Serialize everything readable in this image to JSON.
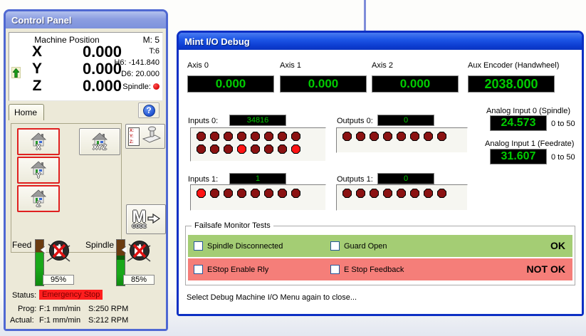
{
  "control_panel": {
    "title": "Control Panel",
    "machine_position": {
      "header": "Machine Position",
      "m": "M: 5",
      "t": "T:6",
      "h": "H6: -141.840",
      "d": "D6: 20.000",
      "spindle_label": "Spindle:",
      "axes": [
        {
          "letter": "X",
          "value": "0.000"
        },
        {
          "letter": "Y",
          "value": "0.000"
        },
        {
          "letter": "Z",
          "value": "0.000"
        }
      ]
    },
    "tab": "Home",
    "help_glyph": "?",
    "buttons": {
      "home_x": "X",
      "home_xyz": "XYZ",
      "home_y": "Y",
      "home_z": "Z"
    },
    "probe": {
      "x": "X:",
      "y": "Y:",
      "z": "Z:"
    },
    "mcode": {
      "m": "M",
      "code": "CODE"
    },
    "feed": {
      "label": "Feed",
      "percent": "95%"
    },
    "spindle_override": {
      "label": "Spindle",
      "percent": "85%"
    },
    "status": {
      "label": "Status:",
      "value": "Emergency Stop"
    },
    "prog": {
      "label": "Prog:",
      "feed": "F:1 mm/min",
      "speed": "S:250 RPM"
    },
    "actual": {
      "label": "Actual:",
      "feed": "F:1 mm/min",
      "speed": "S:212 RPM"
    }
  },
  "io_debug": {
    "title": "Mint I/O Debug",
    "axes": [
      {
        "label": "Axis 0",
        "value": "0.000"
      },
      {
        "label": "Axis 1",
        "value": "0.000"
      },
      {
        "label": "Axis 2",
        "value": "0.000"
      }
    ],
    "aux": {
      "label": "Aux Encoder (Handwheel)",
      "value": "2038.000"
    },
    "inputs0": {
      "label": "Inputs 0:",
      "value": "34816",
      "leds": [
        [
          0,
          0,
          0,
          0,
          0,
          0,
          0,
          0
        ],
        [
          0,
          0,
          0,
          1,
          0,
          0,
          0,
          1
        ]
      ]
    },
    "outputs0": {
      "label": "Outputs 0:",
      "value": "0",
      "leds": [
        [
          0,
          0,
          0,
          0,
          0,
          0,
          0,
          0
        ]
      ]
    },
    "inputs1": {
      "label": "Inputs 1:",
      "value": "1",
      "leds": [
        [
          1,
          0,
          0,
          0,
          0,
          0,
          0,
          0
        ]
      ]
    },
    "outputs1": {
      "label": "Outputs 1:",
      "value": "0",
      "leds": [
        [
          0,
          0,
          0,
          0,
          0,
          0,
          0,
          0
        ]
      ]
    },
    "analog0": {
      "label": "Analog Input 0 (Spindle)",
      "value": "24.573",
      "range": "0 to 50"
    },
    "analog1": {
      "label": "Analog Input 1 (Feedrate)",
      "value": "31.607",
      "range": "0 to 50"
    },
    "failsafe": {
      "title": "Failsafe Monitor Tests",
      "rows": [
        {
          "check1": "Spindle Disconnected",
          "check2": "Guard Open",
          "status": "OK"
        },
        {
          "check1": "EStop Enable Rly",
          "check2": "E Stop Feedback",
          "status": "NOT OK"
        }
      ]
    },
    "footer": "Select Debug Machine I/O Menu again to close..."
  },
  "colors": {
    "title_active": "#1d55e6",
    "title_inactive": "#8c9ee1",
    "lcd_green": "#00cc00",
    "led_on": "#ff1414",
    "led_off": "#8b1212",
    "ok_row": "#a4cd74",
    "notok_row": "#f57e79",
    "status_red": "#ff1e1e",
    "selected_button_red": "#e02020"
  }
}
